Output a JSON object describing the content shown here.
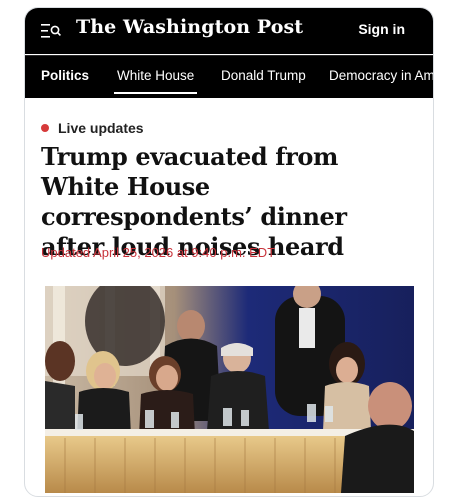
{
  "header": {
    "logo": "The Washington Post",
    "signin_label": "Sign in",
    "menu_icon": "menu-search-icon"
  },
  "nav": {
    "items": [
      {
        "label": "Politics"
      },
      {
        "label": "White House"
      },
      {
        "label": "Donald Trump"
      },
      {
        "label": "Democracy in Am"
      }
    ]
  },
  "article": {
    "live_label": "Live updates",
    "live_dot_color": "#d63a3a",
    "headline": "Trump evacuated from White House correspondents’ dinner after loud noises heard",
    "updated": "Updated April 25, 2026 at 9:40 p.m. EDT",
    "updated_color": "#c8323a"
  }
}
